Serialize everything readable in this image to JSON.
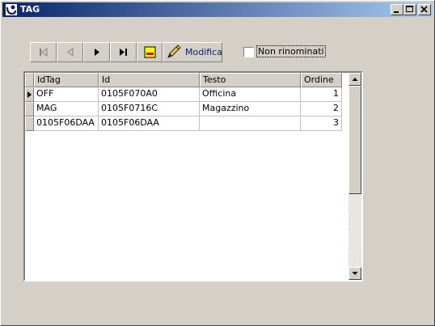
{
  "window": {
    "title": "TAG"
  },
  "toolbar": {
    "modifica_label": "Modifica"
  },
  "filter": {
    "label": "Non rinominati",
    "checked": false
  },
  "grid": {
    "columns": [
      "IdTag",
      "Id",
      "Testo",
      "Ordine"
    ],
    "rows": [
      {
        "idtag": "OFF",
        "id": "0105F070A0",
        "testo": "Officina",
        "ordine": "1"
      },
      {
        "idtag": "MAG",
        "id": "0105F0716C",
        "testo": "Magazzino",
        "ordine": "2"
      },
      {
        "idtag": "0105F06DAA",
        "id": "0105F06DAA",
        "testo": "",
        "ordine": "3"
      }
    ]
  }
}
